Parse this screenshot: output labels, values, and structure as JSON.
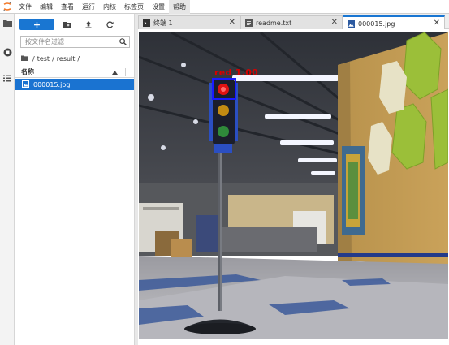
{
  "menu": [
    "文件",
    "编辑",
    "查看",
    "运行",
    "内核",
    "标签页",
    "设置",
    "帮助"
  ],
  "activity_icons": [
    "folder-icon",
    "running-kernels-icon",
    "table-of-contents-icon"
  ],
  "file_browser": {
    "new_label": "+",
    "search_placeholder": "按文件名过滤",
    "breadcrumb": [
      "/",
      "test",
      "/",
      "result",
      "/"
    ],
    "column_header": "名称",
    "files": [
      {
        "name": "000015.jpg",
        "selected": true
      }
    ]
  },
  "tabs": [
    {
      "label": "终端 1",
      "icon": "terminal-icon",
      "active": false
    },
    {
      "label": "readme.txt",
      "icon": "text-file-icon",
      "active": false
    },
    {
      "label": "000015.jpg",
      "icon": "image-file-icon",
      "active": true
    }
  ],
  "image": {
    "detection_label": "red  1.00",
    "box_color": "#1a1aff",
    "label_color": "#d60000"
  },
  "colors": {
    "accent": "#1976d2",
    "selected_row": "#1a73d1",
    "logo": "#f37726"
  }
}
